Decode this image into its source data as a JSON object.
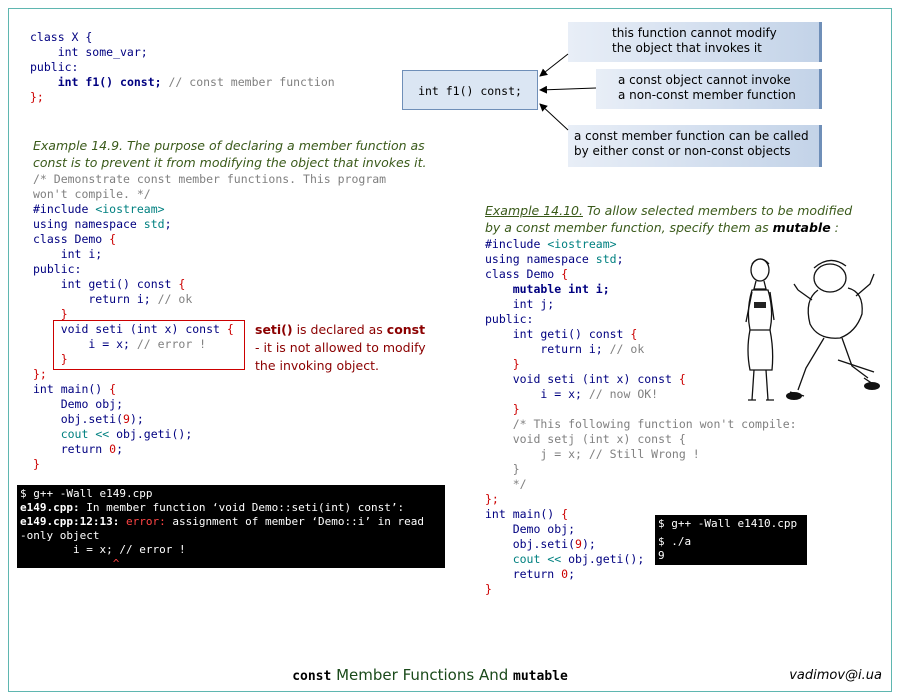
{
  "class_x": {
    "line1": "class X {",
    "line2": "    int some_var;",
    "line3": "public:",
    "line4_decl": "int f1() const;",
    "line4_comment": "// const member function",
    "line5": "};"
  },
  "signature_box": "int f1() const;",
  "callouts": {
    "c1": "this function cannot modify\nthe object that invokes it",
    "c2": "a const object cannot invoke\na non-const member function",
    "c3": "a const member function can be called\nby either const or non-const objects"
  },
  "example_149": {
    "caption_head": "Example 14.9.",
    "caption_body": " The purpose of declaring a member function as const is to prevent it from modifying the object that invokes it.",
    "comment1": "/* Demonstrate const member functions. This program",
    "comment2": "won't compile. */",
    "note_bold1": "seti()",
    "note_mid": " is declared as ",
    "note_bold2": "const",
    "note_end": " - it is not allowed to modify the invoking object."
  },
  "terminal_149": {
    "line1": "$ g++ -Wall e149.cpp",
    "line2_file": "e149.cpp:",
    "line2_rest": " In member function ‘void Demo::seti(int) const’:",
    "line3_file": "e149.cpp:12:13:",
    "line3_err": " error:",
    "line3_rest": " assignment of member ‘Demo::i’ in read",
    "line4": "-only object",
    "line5": "        i = x; // error !",
    "line6": "              ^"
  },
  "example_1410": {
    "caption_head": "Example 14.10.",
    "caption_body": " To allow selected members to be modified by a const member function, specify them as ",
    "caption_kw": "mutable",
    "caption_tail": " :"
  },
  "terminal_1410": {
    "line1": "$ g++ -Wall e1410.cpp",
    "line2": "$ ./a",
    "line3": "9"
  },
  "footer": {
    "kw1": "const",
    "text": " Member Functions And ",
    "kw2": "mutable",
    "email": "vadimov@i.ua"
  }
}
